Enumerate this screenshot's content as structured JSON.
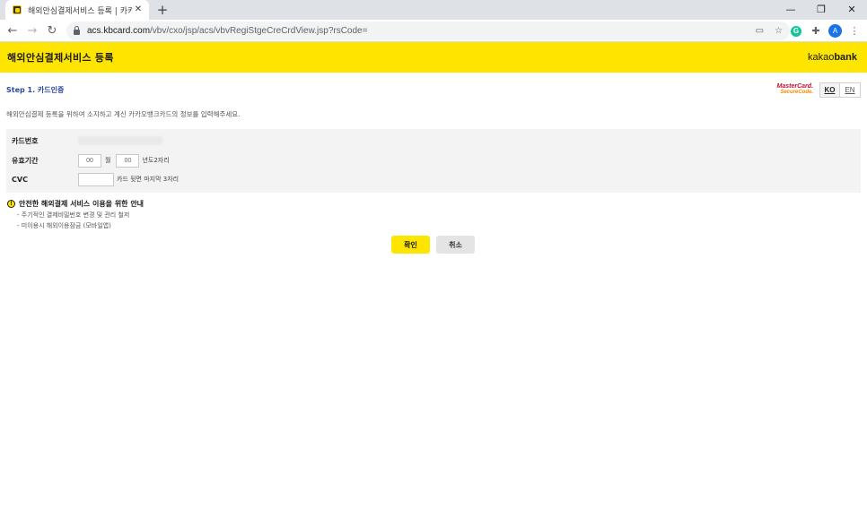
{
  "browser": {
    "tab_title": "해외안심결제서비스 등록 | 카카오",
    "tab_close": "✕",
    "new_tab": "+",
    "url_host": "acs.kbcard.com",
    "url_path": "/vbv/cxo/jsp/acs/vbvRegiStgeCreCrdView.jsp?rsCode=",
    "profile_initial": "A",
    "extension_initial": "G",
    "window_controls": {
      "minimize": "—",
      "restore": "❐",
      "close": "✕"
    },
    "nav": {
      "back": "←",
      "forward": "→",
      "reload": "↻"
    },
    "icons": [
      "reader-mode-icon",
      "star-icon",
      "grammarly-icon",
      "puzzle-icon",
      "profile-avatar",
      "kebab-menu-icon"
    ],
    "toolbar_glyphs": {
      "reader": "▭",
      "star": "☆",
      "puzzle": "✚",
      "menu": "⋮"
    }
  },
  "page": {
    "title": "해외안심결제서비스 등록",
    "brand_light": "kakao",
    "brand_bold": "bank",
    "step_title": "Step 1. 카드인증",
    "mc_line1": "MasterCard.",
    "mc_line2": "SecureCode.",
    "lang_ko": "KO",
    "lang_en": "EN",
    "description": "해외안심결제 등록을 위하여 소지하고 계신 카카오뱅크카드의 정보를 입력해주세요.",
    "form": {
      "card_number_label": "카드번호",
      "expiry_label": "유효기간",
      "expiry_month": "00",
      "month_unit": "월",
      "expiry_year": "00",
      "year_hint": "년도2자리",
      "cvc_label": "CVC",
      "cvc_hint": "카드 뒷면 마지막 3자리"
    },
    "notice": {
      "icon": "!",
      "title": "안전한 해외결제 서비스 이용을 위한 안내",
      "items": [
        "- 주기적인 결제비밀번호 변경 및 관리 철저",
        "- 미이용시 해외이용잠금 (모바일앱)"
      ]
    },
    "buttons": {
      "confirm": "확인",
      "cancel": "취소"
    }
  },
  "colors": {
    "header_yellow": "#fee500",
    "step_blue": "#2c4a9c",
    "form_bg": "#f3f3f3",
    "cancel_bg": "#e4e4e4"
  }
}
